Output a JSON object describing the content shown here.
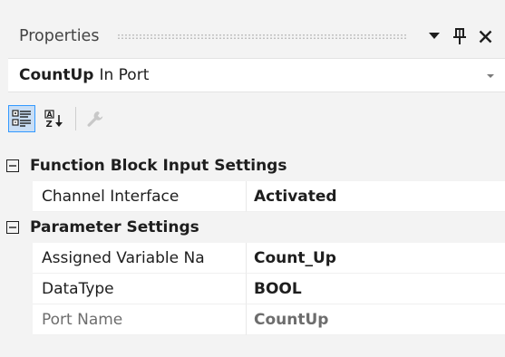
{
  "window": {
    "title": "Properties",
    "dropdown_icon": "caret-down-icon",
    "pin_icon": "pin-icon",
    "close_icon": "close-icon"
  },
  "selector": {
    "object_name": "CountUp",
    "object_type": "In Port"
  },
  "toolbar": {
    "buttons": [
      {
        "icon": "categorized-icon",
        "active": true
      },
      {
        "icon": "alphabetical-sort-icon",
        "active": false
      },
      {
        "icon": "property-pages-wrench-icon",
        "active": false
      }
    ]
  },
  "grid": {
    "categories": [
      {
        "label": "Function Block Input Settings",
        "expanded": true,
        "properties": [
          {
            "name": "Channel Interface",
            "value": "Activated",
            "readonly": false
          }
        ]
      },
      {
        "label": "Parameter Settings",
        "expanded": true,
        "properties": [
          {
            "name": "Assigned Variable Na",
            "value": "Count_Up",
            "readonly": false
          },
          {
            "name": "DataType",
            "value": "BOOL",
            "readonly": false
          },
          {
            "name": "Port Name",
            "value": "CountUp",
            "readonly": true
          }
        ]
      }
    ]
  },
  "colors": {
    "panel_bg": "#f3f3f3",
    "selection_bg": "#c9def5",
    "selection_border": "#3399ff",
    "readonly_text": "#6d6d6d"
  }
}
